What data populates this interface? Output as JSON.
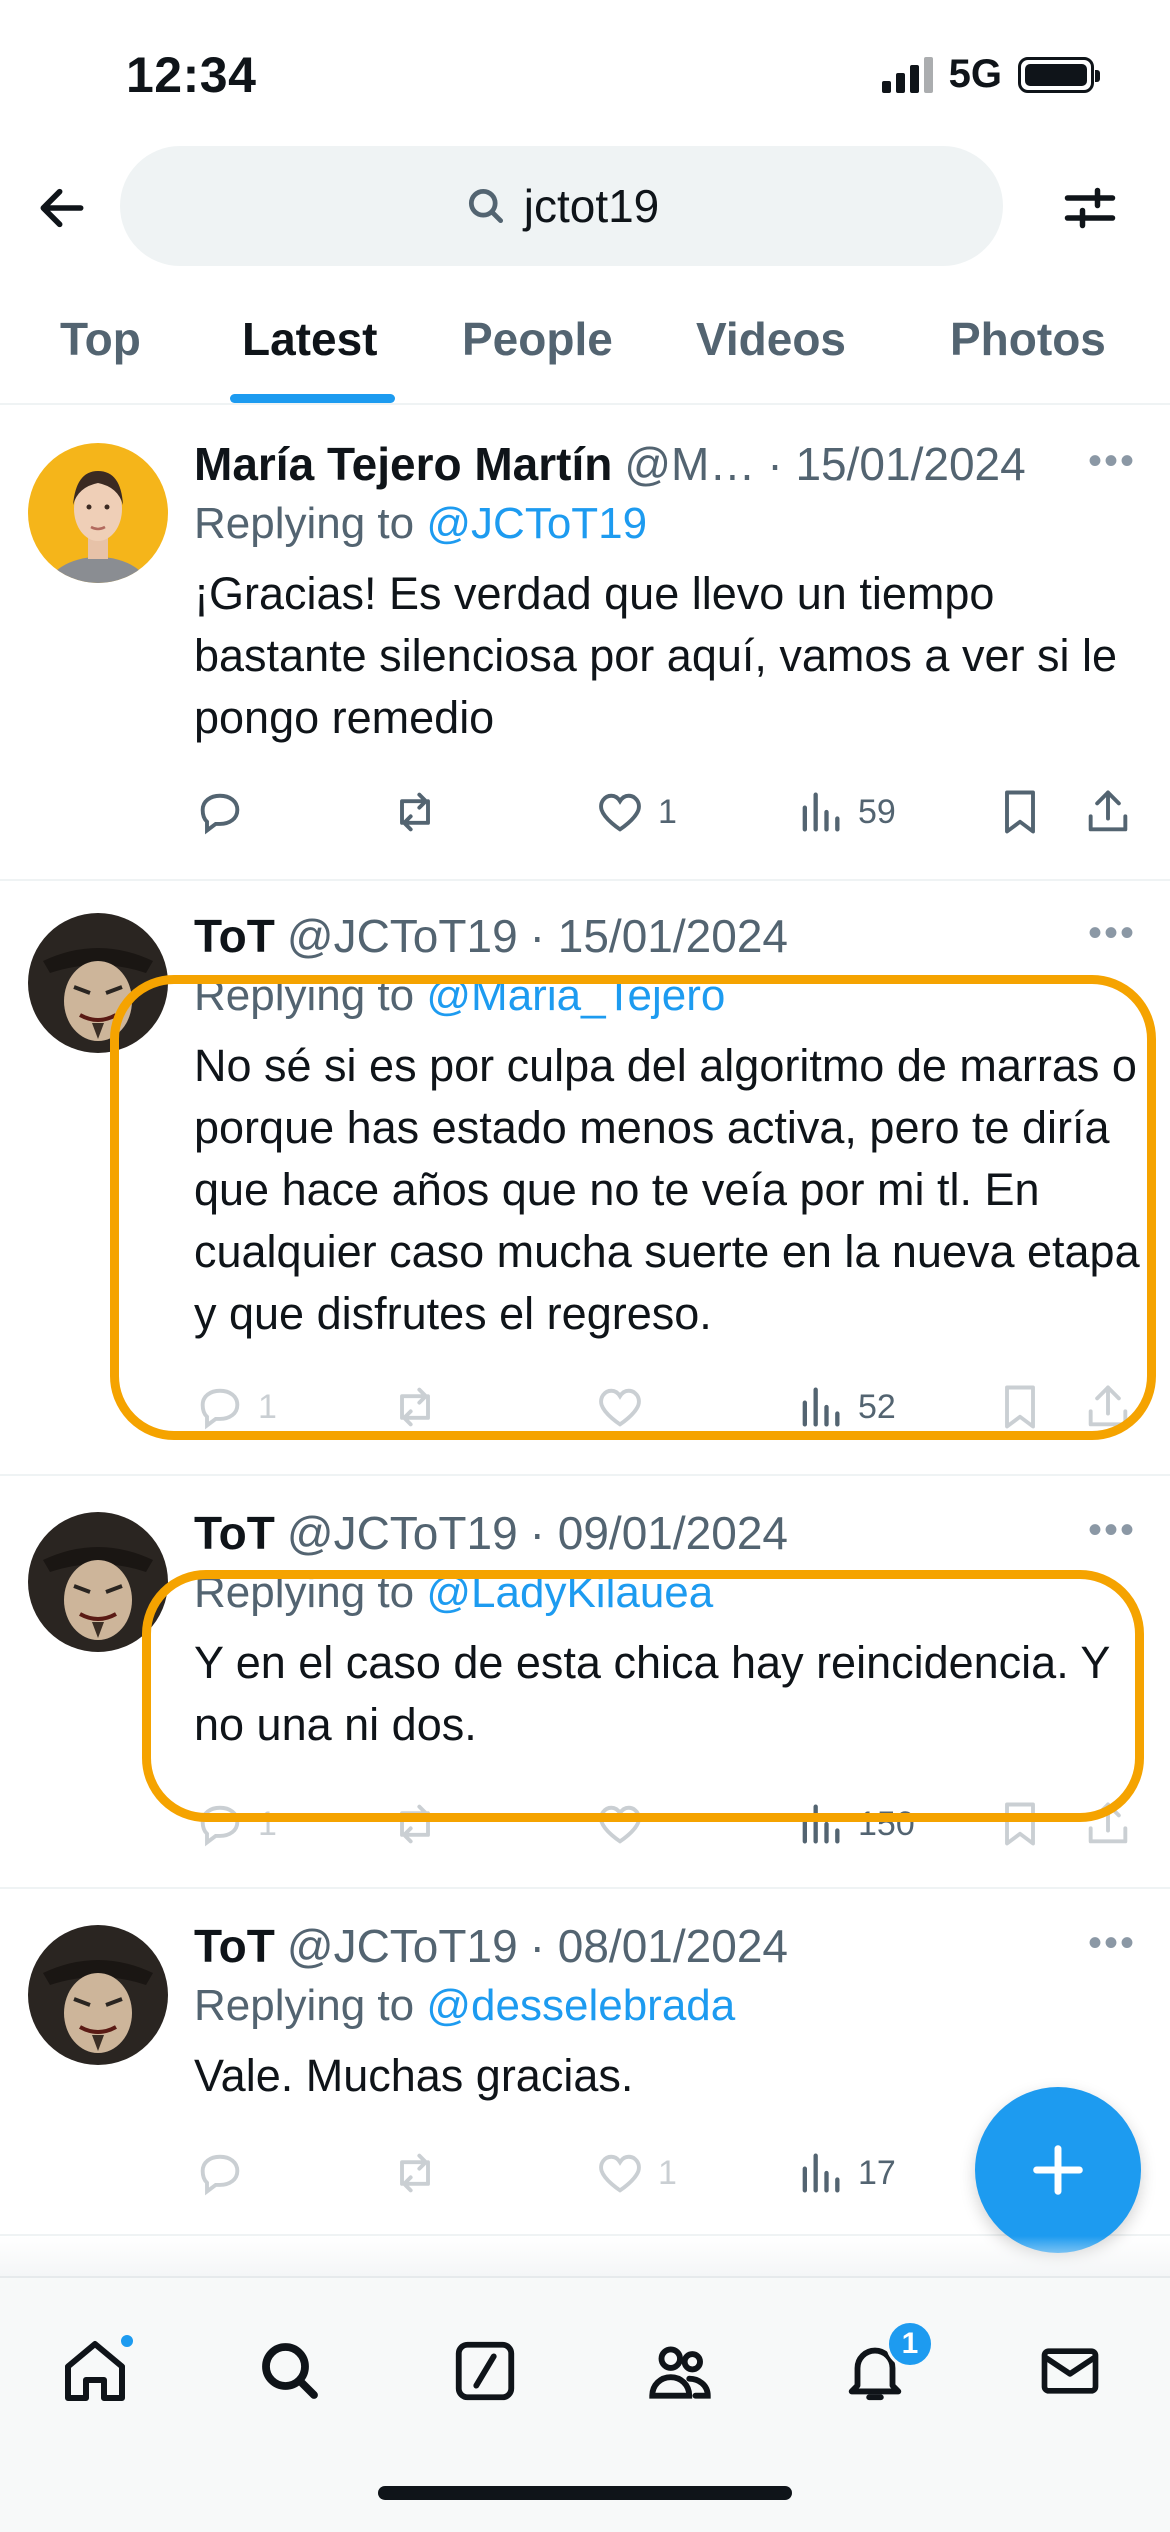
{
  "status_bar": {
    "time": "12:34",
    "network": "5G"
  },
  "search": {
    "query": "jctot19"
  },
  "tabs": [
    {
      "label": "Top"
    },
    {
      "label": "Latest"
    },
    {
      "label": "People"
    },
    {
      "label": "Videos"
    },
    {
      "label": "Photos"
    }
  ],
  "active_tab": "Latest",
  "tweets": [
    {
      "author": "María Tejero Martín",
      "handle": "@M…",
      "date": "· 15/01/2024",
      "reply_label": "Replying to",
      "reply_to": "@JCToT19",
      "text": "¡Gracias! Es verdad que llevo un tiempo bastante silenciosa por aquí, vamos a ver si le pongo remedio",
      "counts": {
        "replies": "",
        "reposts": "",
        "likes": "1",
        "views": "59"
      }
    },
    {
      "author": "ToT",
      "handle": "@JCToT19",
      "date": "· 15/01/2024",
      "reply_label": "Replying to",
      "reply_to": "@Maria_Tejero",
      "text": "No sé si es por culpa del algoritmo de marras o porque has estado menos activa, pero te diría que hace años que no te veía por mi tl. En cualquier caso mucha suerte en la nueva etapa y que disfrutes el regreso.",
      "counts": {
        "replies": "1",
        "reposts": "",
        "likes": "",
        "views": "52"
      },
      "highlighted": true
    },
    {
      "author": "ToT",
      "handle": "@JCToT19",
      "date": "· 09/01/2024",
      "reply_label": "Replying to",
      "reply_to": "@LadyKilauea",
      "text": "Y en el caso de esta chica hay reincidencia. Y no una ni dos.",
      "counts": {
        "replies": "1",
        "reposts": "",
        "likes": "",
        "views": "150"
      },
      "highlighted": true
    },
    {
      "author": "ToT",
      "handle": "@JCToT19",
      "date": "· 08/01/2024",
      "reply_label": "Replying to",
      "reply_to": "@desselebrada",
      "text": "Vale. Muchas gracias.",
      "counts": {
        "replies": "",
        "reposts": "",
        "likes": "1",
        "views": "17"
      }
    }
  ],
  "bottom_nav": {
    "items": [
      "home-icon",
      "search-icon",
      "grok-icon",
      "communities-icon",
      "notifications-icon",
      "messages-icon"
    ],
    "notification_badge": "1"
  },
  "colors": {
    "accent": "#1d9bf0",
    "highlight": "#f5a300",
    "secondary_text": "#536471"
  }
}
